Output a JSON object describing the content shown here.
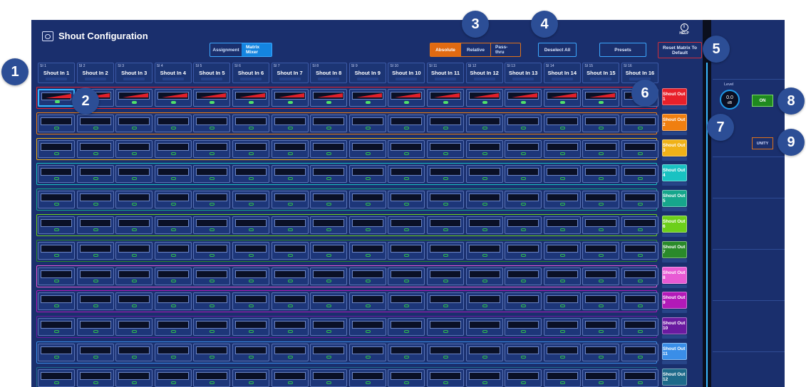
{
  "window": {
    "title": "Shout Configuration",
    "help_label": "HELP"
  },
  "view_tabs": [
    "Assignment",
    "Matrix Mixer"
  ],
  "view_tabs_active": "Matrix Mixer",
  "modes": [
    "Absolute",
    "Relative",
    "Pass-thru"
  ],
  "modes_active": "Absolute",
  "buttons": {
    "deselect_all": "Deselect All",
    "presets": "Presets",
    "reset_matrix": "Reset Matrix To Default"
  },
  "inputs": [
    {
      "num": "SI 1",
      "name": "Shout In 1"
    },
    {
      "num": "SI 2",
      "name": "Shout In 2"
    },
    {
      "num": "SI 3",
      "name": "Shout In 3"
    },
    {
      "num": "SI 4",
      "name": "Shout In 4"
    },
    {
      "num": "SI 5",
      "name": "Shout In 5"
    },
    {
      "num": "SI 6",
      "name": "Shout In 6"
    },
    {
      "num": "SI 7",
      "name": "Shout In 7"
    },
    {
      "num": "SI 8",
      "name": "Shout In 8"
    },
    {
      "num": "SI 9",
      "name": "Shout In 9"
    },
    {
      "num": "SI 10",
      "name": "Shout In 10"
    },
    {
      "num": "SI 11",
      "name": "Shout In 11"
    },
    {
      "num": "SI 12",
      "name": "Shout In 12"
    },
    {
      "num": "SI 13",
      "name": "Shout In 13"
    },
    {
      "num": "SI 14",
      "name": "Shout In 14"
    },
    {
      "num": "SI 15",
      "name": "Shout In 15"
    },
    {
      "num": "SI 16",
      "name": "Shout In 16"
    }
  ],
  "outputs": [
    {
      "name": "Shout Out 1",
      "color": "#e8202a",
      "active": true
    },
    {
      "name": "Shout Out 2",
      "color": "#f07f10",
      "active": false
    },
    {
      "name": "Shout Out 3",
      "color": "#f0b218",
      "active": false
    },
    {
      "name": "Shout Out 4",
      "color": "#19c2c2",
      "active": false
    },
    {
      "name": "Shout Out 5",
      "color": "#16a68c",
      "active": false
    },
    {
      "name": "Shout Out 6",
      "color": "#6ccf1a",
      "active": false
    },
    {
      "name": "Shout Out 7",
      "color": "#2a8a2a",
      "active": false
    },
    {
      "name": "Shout Out 8",
      "color": "#e85ad4",
      "active": false
    },
    {
      "name": "Shout Out 9",
      "color": "#b21ab8",
      "active": false
    },
    {
      "name": "Shout Out 10",
      "color": "#6a1aa0",
      "active": false
    },
    {
      "name": "Shout Out 11",
      "color": "#3a8ee8",
      "active": false
    },
    {
      "name": "Shout Out 12",
      "color": "#1d6a8a",
      "active": false
    }
  ],
  "right_panel": {
    "level_label": "Level",
    "level_value": "0.0",
    "level_unit": "dB",
    "on_label": "ON",
    "unity_label": "UNITY"
  },
  "callouts": [
    "1",
    "2",
    "3",
    "4",
    "5",
    "6",
    "7",
    "8",
    "9"
  ],
  "colors": {
    "background": "#1a2f6d",
    "accent_blue": "#3da8ff",
    "accent_orange": "#e06a12",
    "on_green": "#1f8a1f"
  }
}
